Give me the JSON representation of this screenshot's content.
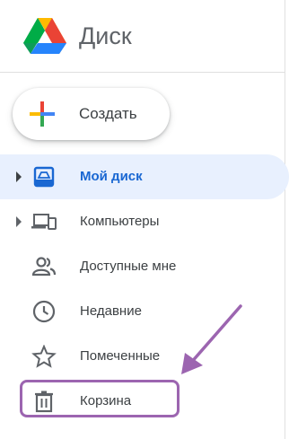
{
  "app": {
    "title": "Диск"
  },
  "create_button": {
    "label": "Создать"
  },
  "nav": {
    "items": [
      {
        "label": "Мой диск",
        "icon": "my-drive-icon",
        "expandable": true,
        "active": true
      },
      {
        "label": "Компьютеры",
        "icon": "computers-icon",
        "expandable": true,
        "active": false
      },
      {
        "label": "Доступные мне",
        "icon": "shared-people-icon",
        "expandable": false,
        "active": false
      },
      {
        "label": "Недавние",
        "icon": "clock-icon",
        "expandable": false,
        "active": false
      },
      {
        "label": "Помеченные",
        "icon": "star-icon",
        "expandable": false,
        "active": false
      },
      {
        "label": "Корзина",
        "icon": "trash-icon",
        "expandable": false,
        "active": false
      }
    ]
  },
  "annotation": {
    "highlighted_item": "Корзина",
    "color": "#9c65b0"
  },
  "colors": {
    "active_bg": "#e8f0fe",
    "active_text": "#1967d2",
    "text": "#3c4043",
    "icon": "#5f6368"
  }
}
